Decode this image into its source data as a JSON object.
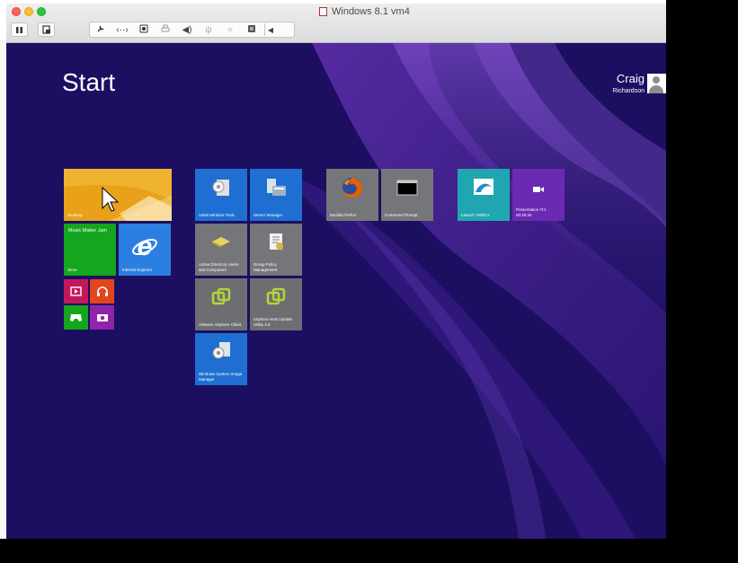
{
  "window": {
    "title": "Windows 8.1 vm4",
    "toolbar": {
      "pause_icon": "pause-icon",
      "snapshot_icon": "snapshot-icon",
      "settings_icon": "wrench-icon",
      "network_icon": "network-icon",
      "disk_icon": "hard-disk-icon",
      "printer_icon": "printer-icon",
      "sound_icon": "speaker-icon",
      "usb_icon": "usb-icon",
      "serial_icon": "serial-icon",
      "sync_icon": "sync-icon",
      "more_icon": "chevron-left-icon"
    }
  },
  "start": {
    "title": "Start",
    "user": {
      "first": "Craig",
      "last": "Richardson"
    }
  },
  "tiles": {
    "desktop": "Desktop",
    "music": "Music Maker Jam",
    "store": "Store",
    "ie": "Internet Explorer",
    "admin_tools": "Administrative Tools",
    "server_manager": "Server Manager",
    "ad_users": "Active Directory Users and Computers",
    "group_policy": "Group Policy Management",
    "vsphere_client": "VMware vSphere Client",
    "vsphere_update": "vSphere Host Update Utility 4.0",
    "system_image": "Windows System Image Manager",
    "firefox": "Mozilla Firefox",
    "cmd": "Command Prompt",
    "vmrc": "Launch VMRCs",
    "presentation": "Presentation IT.1 00:25:34"
  },
  "colors": {
    "background": "#1c0f61",
    "desktop_tile": "#e8a119",
    "store_tile": "#14a61f",
    "ie_tile": "#2b7fe0",
    "blue_tile": "#1e6fd1",
    "gray_tile": "#75767a",
    "olive_tile": "#6d6e72",
    "teal_tile": "#20a6b0",
    "purple_tile": "#6a2ab4"
  }
}
